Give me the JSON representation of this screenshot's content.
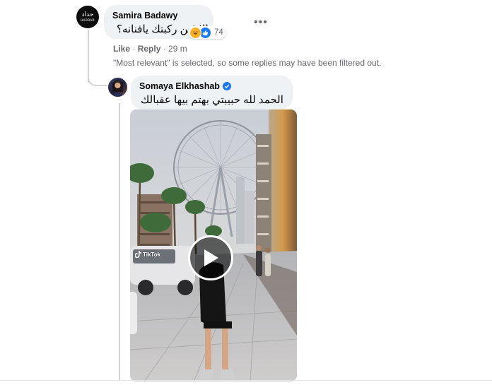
{
  "comment": {
    "author": "Samira Badawy",
    "avatar_main": "حداد",
    "avatar_sub": "HADDAD",
    "text": "الا فين ركبتك يافنانه؟",
    "reactions": {
      "icons": [
        "haha-icon",
        "like-icon"
      ],
      "count": "74"
    },
    "like_label": "Like",
    "separator": " · ",
    "reply_label": "Reply",
    "time": "29 m",
    "more_icon": "more-horizontal-icon"
  },
  "notice": "\"Most relevant\" is selected, so some replies may have been filtered out.",
  "reply": {
    "author": "Somaya Elkhashab",
    "verified_icon": "verified-badge-icon",
    "text": "الحمد لله حبيبتي بهتم بيها عقبالك",
    "video": {
      "play_icon": "play-icon",
      "watermark": "TikTok"
    }
  },
  "colors": {
    "bubble": "#eff2f5",
    "meta": "#65676b",
    "like_blue": "#1877f2",
    "haha_yellow": "#f7b125"
  }
}
